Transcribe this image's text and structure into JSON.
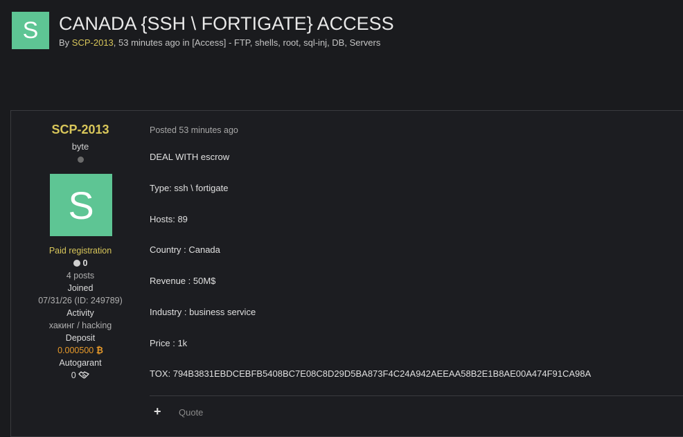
{
  "topic": {
    "avatar_letter": "S",
    "title": "CANADA {SSH \\ FORTIGATE} ACCESS",
    "by_prefix": "By ",
    "author": "SCP-2013",
    "time_text": ", 53 minutes ago in ",
    "category": "[Access] - FTP, shells, root, sql-inj, DB, Servers"
  },
  "author_panel": {
    "name": "SCP-2013",
    "rank": "byte",
    "avatar_letter": "S",
    "group": "Paid registration",
    "reputation": "0",
    "posts": "4 posts",
    "joined_label": "Joined",
    "joined_value": "07/31/26 (ID: 249789)",
    "activity_label": "Activity",
    "activity_value": "хакинг / hacking",
    "deposit_label": "Deposit",
    "deposit_value": "0.000500",
    "deposit_icon": "₿",
    "autogarant_label": "Autogarant",
    "autogarant_value": "0",
    "autogarant_icon": "handshake-icon"
  },
  "post": {
    "posted": "Posted 53 minutes ago",
    "lines": [
      "DEAL WITH escrow",
      "Type: ssh \\ fortigate",
      "Hosts: 89",
      "Country : Canada",
      "Revenue : 50M$",
      "Industry : business service",
      "Price : 1k",
      "TOX: 794B3831EBDCEBFB5408BC7E08C8D29D5BA873F4C24A942AEEAA58B2E1B8AE00A474F91CA98A"
    ],
    "plus_label": "+",
    "quote_label": "Quote"
  },
  "colors": {
    "background": "#1a1b1e",
    "accent_gold": "#d8c65a",
    "avatar_green": "#5ec594",
    "deposit_orange": "#e89a2a"
  }
}
